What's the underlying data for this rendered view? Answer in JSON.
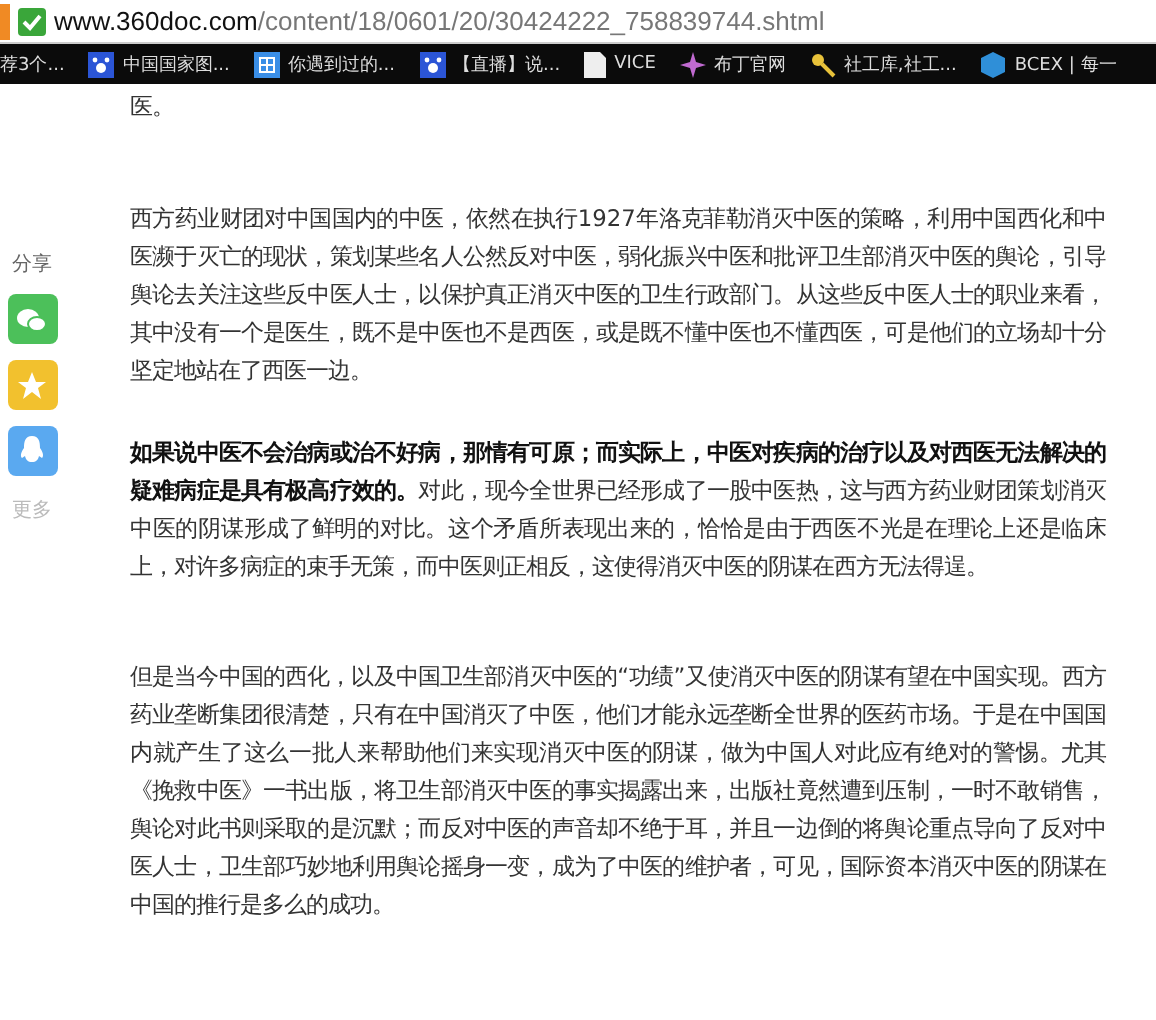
{
  "address_bar": {
    "domain": "www.360doc.com",
    "path": "/content/18/0601/20/30424222_758839744.shtml"
  },
  "bookmarks": [
    {
      "label": "荐3个..."
    },
    {
      "label": "中国国家图..."
    },
    {
      "label": "你遇到过的..."
    },
    {
      "label": "【直播】说..."
    },
    {
      "label": "VICE"
    },
    {
      "label": "布丁官网"
    },
    {
      "label": "社工库,社工..."
    },
    {
      "label": "BCEX | 每一"
    }
  ],
  "share": {
    "label": "分享",
    "more": "更多",
    "buttons": [
      {
        "kind": "wechat"
      },
      {
        "kind": "favorite"
      },
      {
        "kind": "qq"
      }
    ]
  },
  "article": {
    "paragraphs": [
      "医。",
      "西方药业财团对中国国内的中医，依然在执行1927年洛克菲勒消灭中医的策略，利用中国西化和中医濒于灭亡的现状，策划某些名人公然反对中医，弱化振兴中医和批评卫生部消灭中医的舆论，引导舆论去关注这些反中医人士，以保护真正消灭中医的卫生行政部门。从这些反中医人士的职业来看，其中没有一个是医生，既不是中医也不是西医，或是既不懂中医也不懂西医，可是他们的立场却十分坚定地站在了西医一边。",
      "**如果说中医不会治病或治不好病，那情有可原；而实际上，中医对疾病的治疗以及对西医无法解决的疑难病症是具有极高疗效的。**对此，现今全世界已经形成了一股中医热，这与西方药业财团策划消灭中医的阴谋形成了鲜明的对比。这个矛盾所表现出来的，恰恰是由于西医不光是在理论上还是临床上，对许多病症的束手无策，而中医则正相反，这使得消灭中医的阴谋在西方无法得逞。",
      "但是当今中国的西化，以及中国卫生部消灭中医的“功绩”又使消灭中医的阴谋有望在中国实现。西方药业垄断集团很清楚，只有在中国消灭了中医，他们才能永远垄断全世界的医药市场。于是在中国国内就产生了这么一批人来帮助他们来实现消灭中医的阴谋，做为中国人对此应有绝对的警惕。尤其《挽救中医》一书出版，将卫生部消灭中医的事实揭露出来，出版社竟然遭到压制，一时不敢销售，舆论对此书则采取的是沉默；而反对中医的声音却不绝于耳，并且一边倒的将舆论重点导向了反对中医人士，卫生部巧妙地利用舆论摇身一变，成为了中医的维护者，可见，国际资本消灭中医的阴谋在中国的推行是多么的成功。"
    ]
  }
}
